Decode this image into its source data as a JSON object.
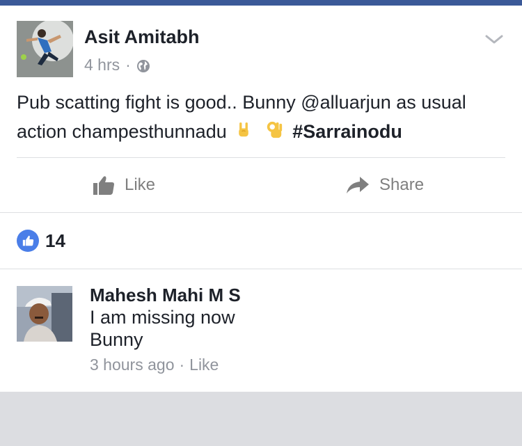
{
  "post": {
    "author": "Asit Amitabh",
    "time": "4 hrs",
    "privacy_icon": "globe-icon",
    "text_before": "Pub scatting fight is good.. Bunny @alluarjun as usual action champesthunnadu",
    "hashtag": "#Sarrainodu",
    "emojis": [
      "rock-on-hand",
      "ok-hand"
    ]
  },
  "actions": {
    "like_label": "Like",
    "share_label": "Share"
  },
  "reactions": {
    "count": "14"
  },
  "comment": {
    "author": "Mahesh Mahi M S",
    "line1": "I am missing now",
    "line2": "Bunny",
    "time": "3 hours ago",
    "like_label": "Like"
  },
  "colors": {
    "brand": "#3b5998",
    "like_blue": "#4a7ee8",
    "meta_gray": "#90949c",
    "text": "#1d2129",
    "action_gray": "#7f7f7f"
  }
}
